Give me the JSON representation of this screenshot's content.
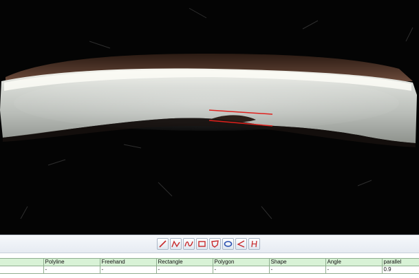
{
  "tools": [
    {
      "name": "line-tool-icon",
      "glyph": "line"
    },
    {
      "name": "polyline-tool-icon",
      "glyph": "polyline"
    },
    {
      "name": "freehand-tool-icon",
      "glyph": "freehand"
    },
    {
      "name": "rectangle-tool-icon",
      "glyph": "rectangle"
    },
    {
      "name": "polygon-tool-icon",
      "glyph": "polygon"
    },
    {
      "name": "shape-tool-icon",
      "glyph": "ellipse"
    },
    {
      "name": "angle-tool-icon",
      "glyph": "angle"
    },
    {
      "name": "parallel-tool-icon",
      "glyph": "parallel"
    }
  ],
  "results": {
    "headers": [
      "",
      "Polyline",
      "Freehand",
      "Rectangle",
      "Polygon",
      "Shape",
      "Angle",
      "parallel"
    ],
    "values": [
      "",
      "-",
      "-",
      "-",
      "-",
      "-",
      "-",
      "0.9"
    ]
  },
  "colors": {
    "measure_line": "#e0201c",
    "tool_icon": "#c8282a",
    "shape_icon": "#2a4fb0",
    "header_bg": "#d8f2d6"
  }
}
